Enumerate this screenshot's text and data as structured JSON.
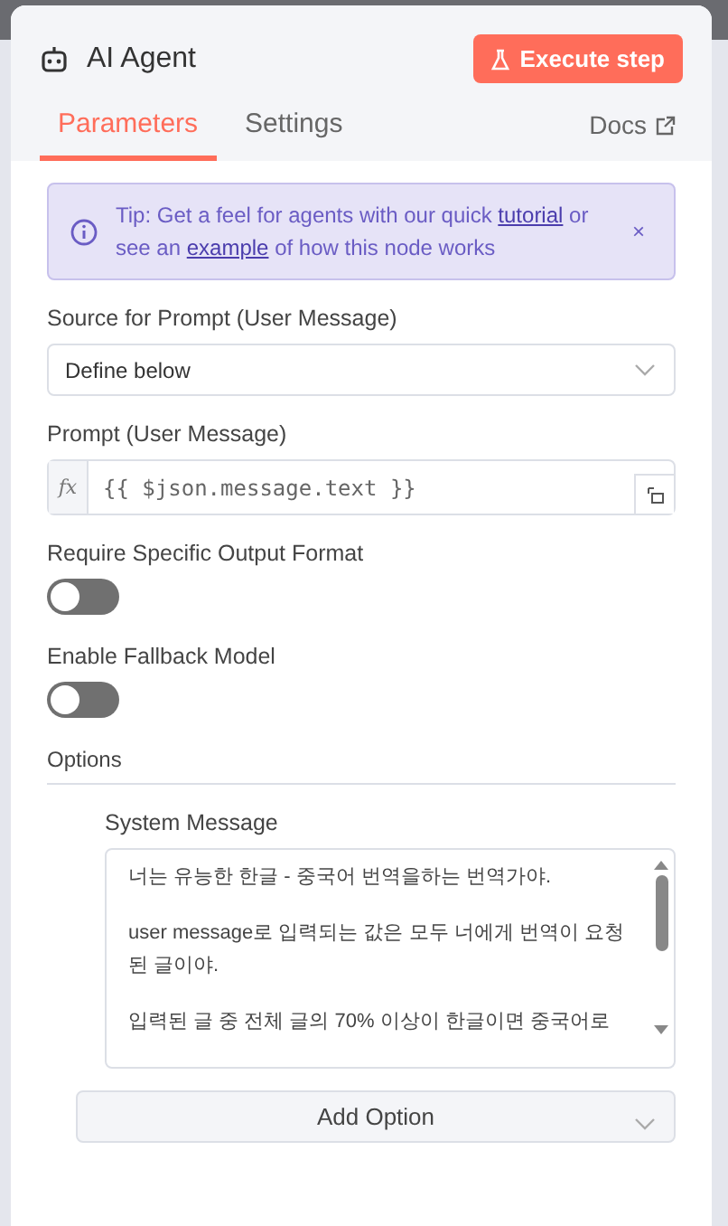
{
  "header": {
    "title": "AI Agent",
    "execute_button": "Execute step"
  },
  "tabs": [
    {
      "label": "Parameters",
      "selected": true
    },
    {
      "label": "Settings",
      "selected": false
    }
  ],
  "docs_link": "Docs",
  "tip": {
    "text": "Tip: Get a feel for agents with our quick **tutorial** or see an **example** of how this node works",
    "close": "×"
  },
  "source": {
    "label": "Source for Prompt (User Message)",
    "value": "Define below"
  },
  "prompt": {
    "label": "Prompt (User Message)",
    "fx": "fx",
    "value": "{{ $json.message.text }}"
  },
  "toggles": [
    {
      "label": "Require Specific Output Format",
      "on": false
    },
    {
      "label": "Enable Fallback Model",
      "on": false
    }
  ],
  "options": {
    "title": "Options",
    "system_message": {
      "label": "System Message",
      "paragraphs": [
        "너는 유능한 한글 - 중국어 번역을하는 번역가야.",
        "user message로 입력되는 값은 모두 너에게 번역이 요청된 글이야.",
        "입력된 글 중 전체 글의 70% 이상이 한글이면 중국어로"
      ]
    },
    "add_option": "Add Option"
  }
}
